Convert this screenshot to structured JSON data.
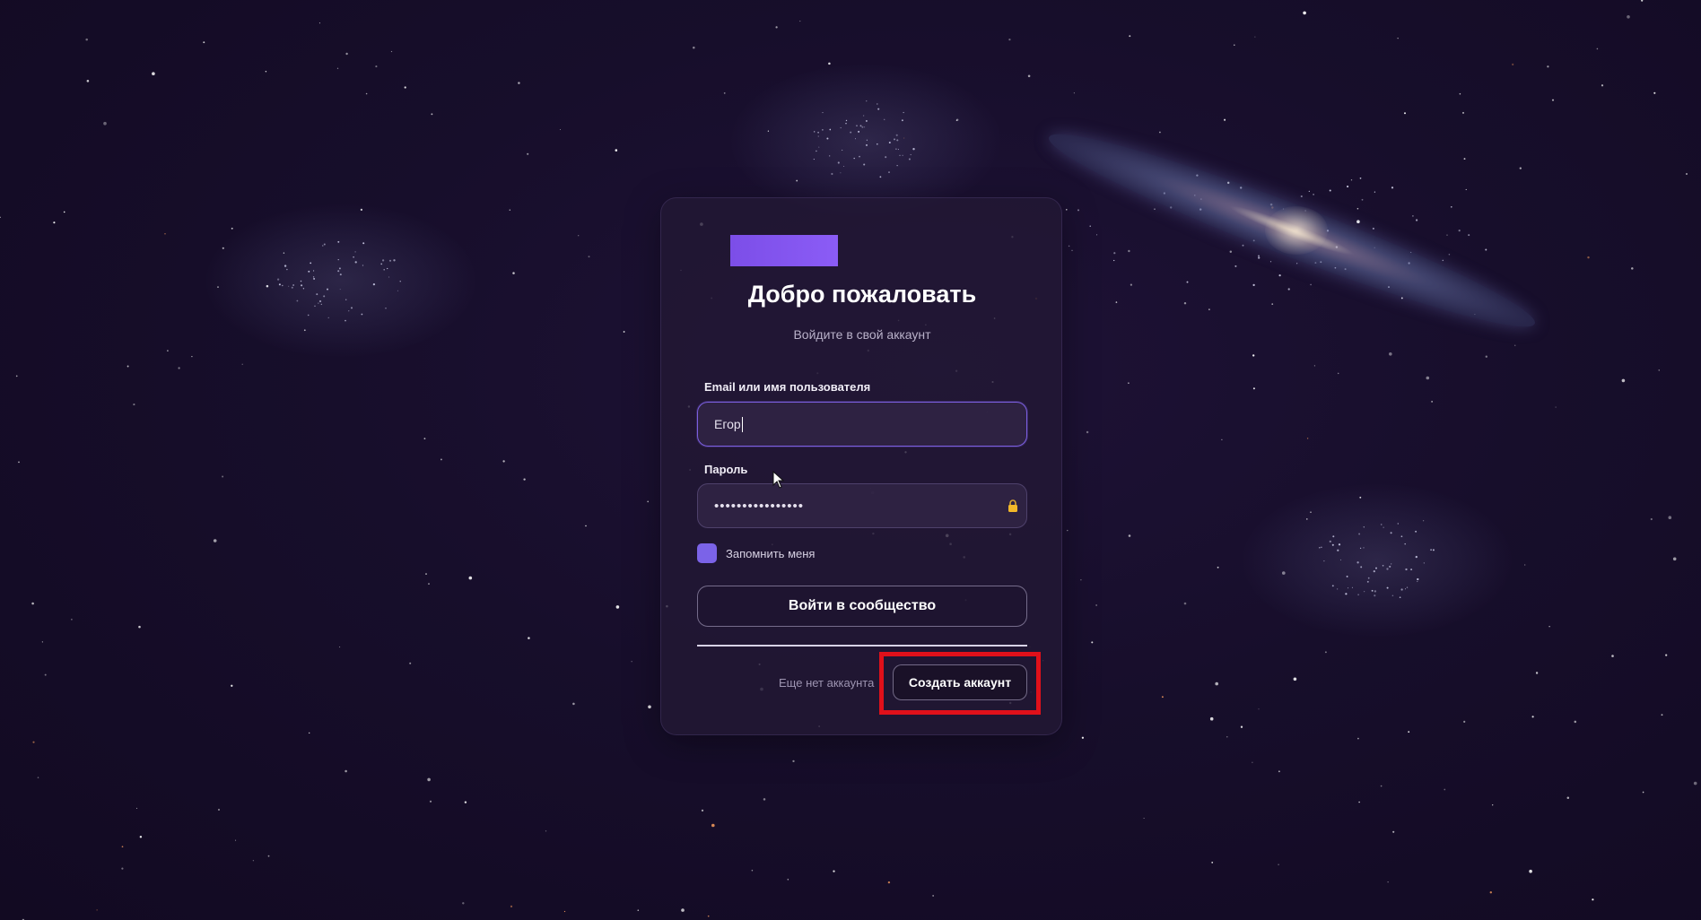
{
  "login_card": {
    "title": "Добро пожаловать",
    "subtitle": "Войдите в свой аккаунт",
    "username_field": {
      "label": "Email или имя пользователя",
      "value": "Егор"
    },
    "password_field": {
      "label": "Пароль",
      "value": "••••••••••••••••",
      "icon": "lock-icon"
    },
    "remember_me": {
      "label": "Запомнить меня",
      "checked": true
    },
    "login_button_label": "Войти в сообщество",
    "signup_prompt": "Еще нет аккаунта",
    "create_account_label": "Создать аккаунт"
  },
  "colors": {
    "accent": "#7b63e8",
    "logo_gradient_start": "#7c4ee8",
    "logo_gradient_end": "#8b5cf6",
    "highlight": "#e0101a",
    "background": "#170e2b"
  }
}
